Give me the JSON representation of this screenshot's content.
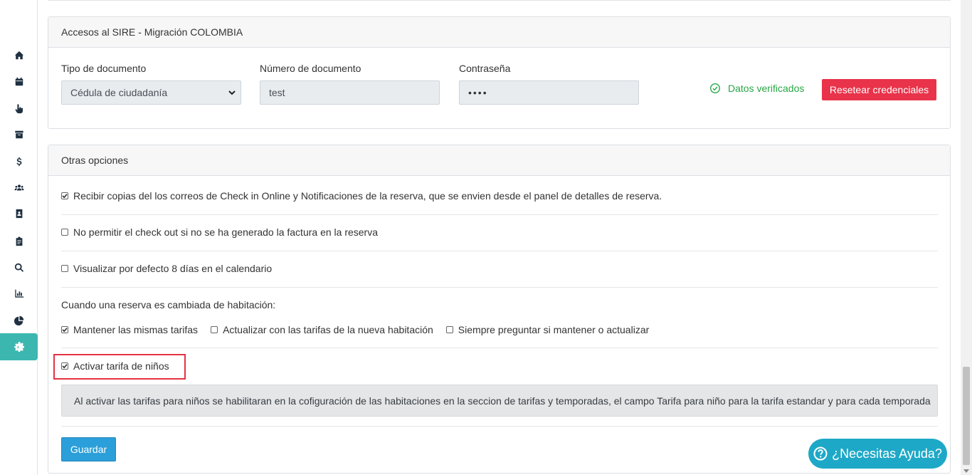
{
  "sidebar": {
    "items": [
      {
        "icon": "home-icon"
      },
      {
        "icon": "calendar-icon"
      },
      {
        "icon": "hand-pointer-icon"
      },
      {
        "icon": "archive-icon"
      },
      {
        "icon": "dollar-icon"
      },
      {
        "icon": "users-icon"
      },
      {
        "icon": "address-book-icon"
      },
      {
        "icon": "clipboard-icon"
      },
      {
        "icon": "search-icon"
      },
      {
        "icon": "bar-chart-icon"
      },
      {
        "icon": "pie-chart-icon"
      },
      {
        "icon": "gear-icon",
        "active": true
      }
    ],
    "accent_color": "#3bb7b0"
  },
  "sire": {
    "title": "Accesos al SIRE - Migración COLOMBIA",
    "doc_type_label": "Tipo de documento",
    "doc_type_value": "Cédula de ciudadanía",
    "doc_number_label": "Número de documento",
    "doc_number_value": "test",
    "password_label": "Contraseña",
    "password_value": "••••",
    "verified_text": "Datos verificados",
    "reset_button": "Resetear credenciales"
  },
  "options": {
    "title": "Otras opciones",
    "opt_email_copies": "Recibir copias del los correos de Check in Online y Notificaciones de la reserva, que se envien desde el panel de detalles de reserva.",
    "opt_no_checkout": "No permitir el check out si no se ha generado la factura en la reserva",
    "opt_eight_days": "Visualizar por defecto 8 días en el calendario",
    "room_change_label": "Cuando una reserva es cambiada de habitación:",
    "opt_keep_rates": "Mantener las mismas tarifas",
    "opt_update_rates": "Actualizar con las tarifas de la nueva habitación",
    "opt_always_ask": "Siempre preguntar si mantener o actualizar",
    "opt_child_rate": "Activar tarifa de niños",
    "info_text": "Al activar las tarifas para niños se habilitaran en la cofiguración de las habitaciones en la seccion de tarifas y temporadas, el campo Tarifa para niño para la tarifa estandar y para cada temporada",
    "save_button": "Guardar"
  },
  "help": {
    "label": "¿Necesitas Ayuda?"
  },
  "colors": {
    "danger": "#e8334a",
    "success": "#28a745",
    "primary": "#2b9fd9",
    "help": "#1ea8c7"
  }
}
